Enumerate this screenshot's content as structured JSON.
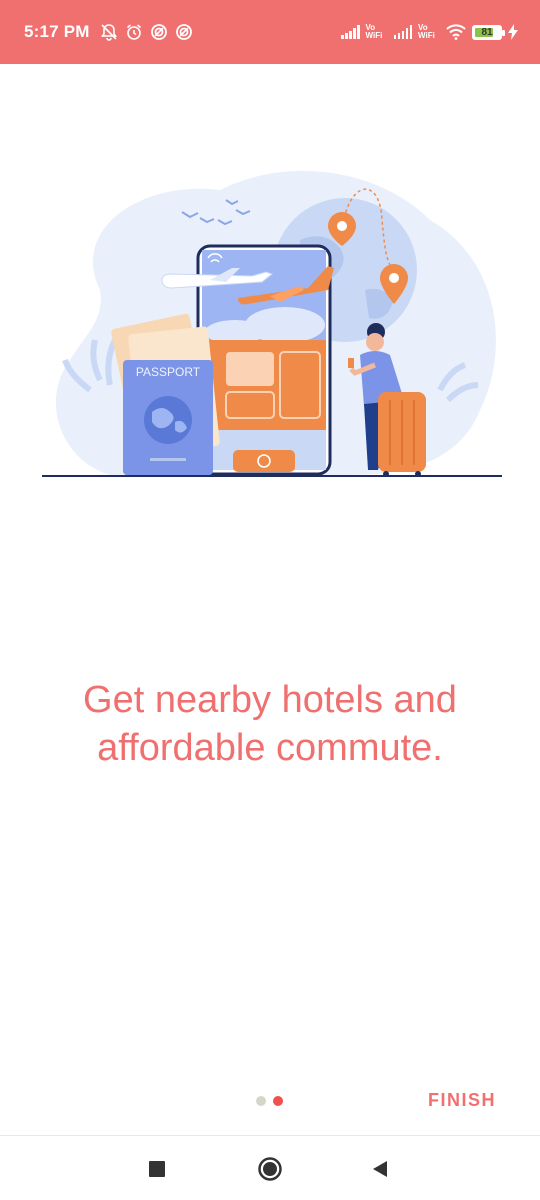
{
  "status_bar": {
    "time": "5:17 PM",
    "left_icons": [
      "bell-off-icon",
      "alarm-icon",
      "sync-icon",
      "sync-icon"
    ],
    "network_label_1": "Vo WiFi",
    "network_label_2": "Vo WiFi",
    "battery": "81",
    "charging": true
  },
  "illustration": {
    "passport_label": "PASSPORT"
  },
  "onboarding": {
    "headline": "Get nearby hotels and affordable commute.",
    "page_count": 2,
    "current_page": 2,
    "finish_label": "FINISH"
  },
  "navigation": {
    "recents": "square-icon",
    "home": "circle-icon",
    "back": "triangle-back-icon"
  },
  "colors": {
    "accent": "#f07070",
    "dot_active": "#f05050",
    "dot_inactive": "#d6d6c8",
    "illustration_blue": "#7b94e8",
    "illustration_orange": "#f08a48"
  }
}
